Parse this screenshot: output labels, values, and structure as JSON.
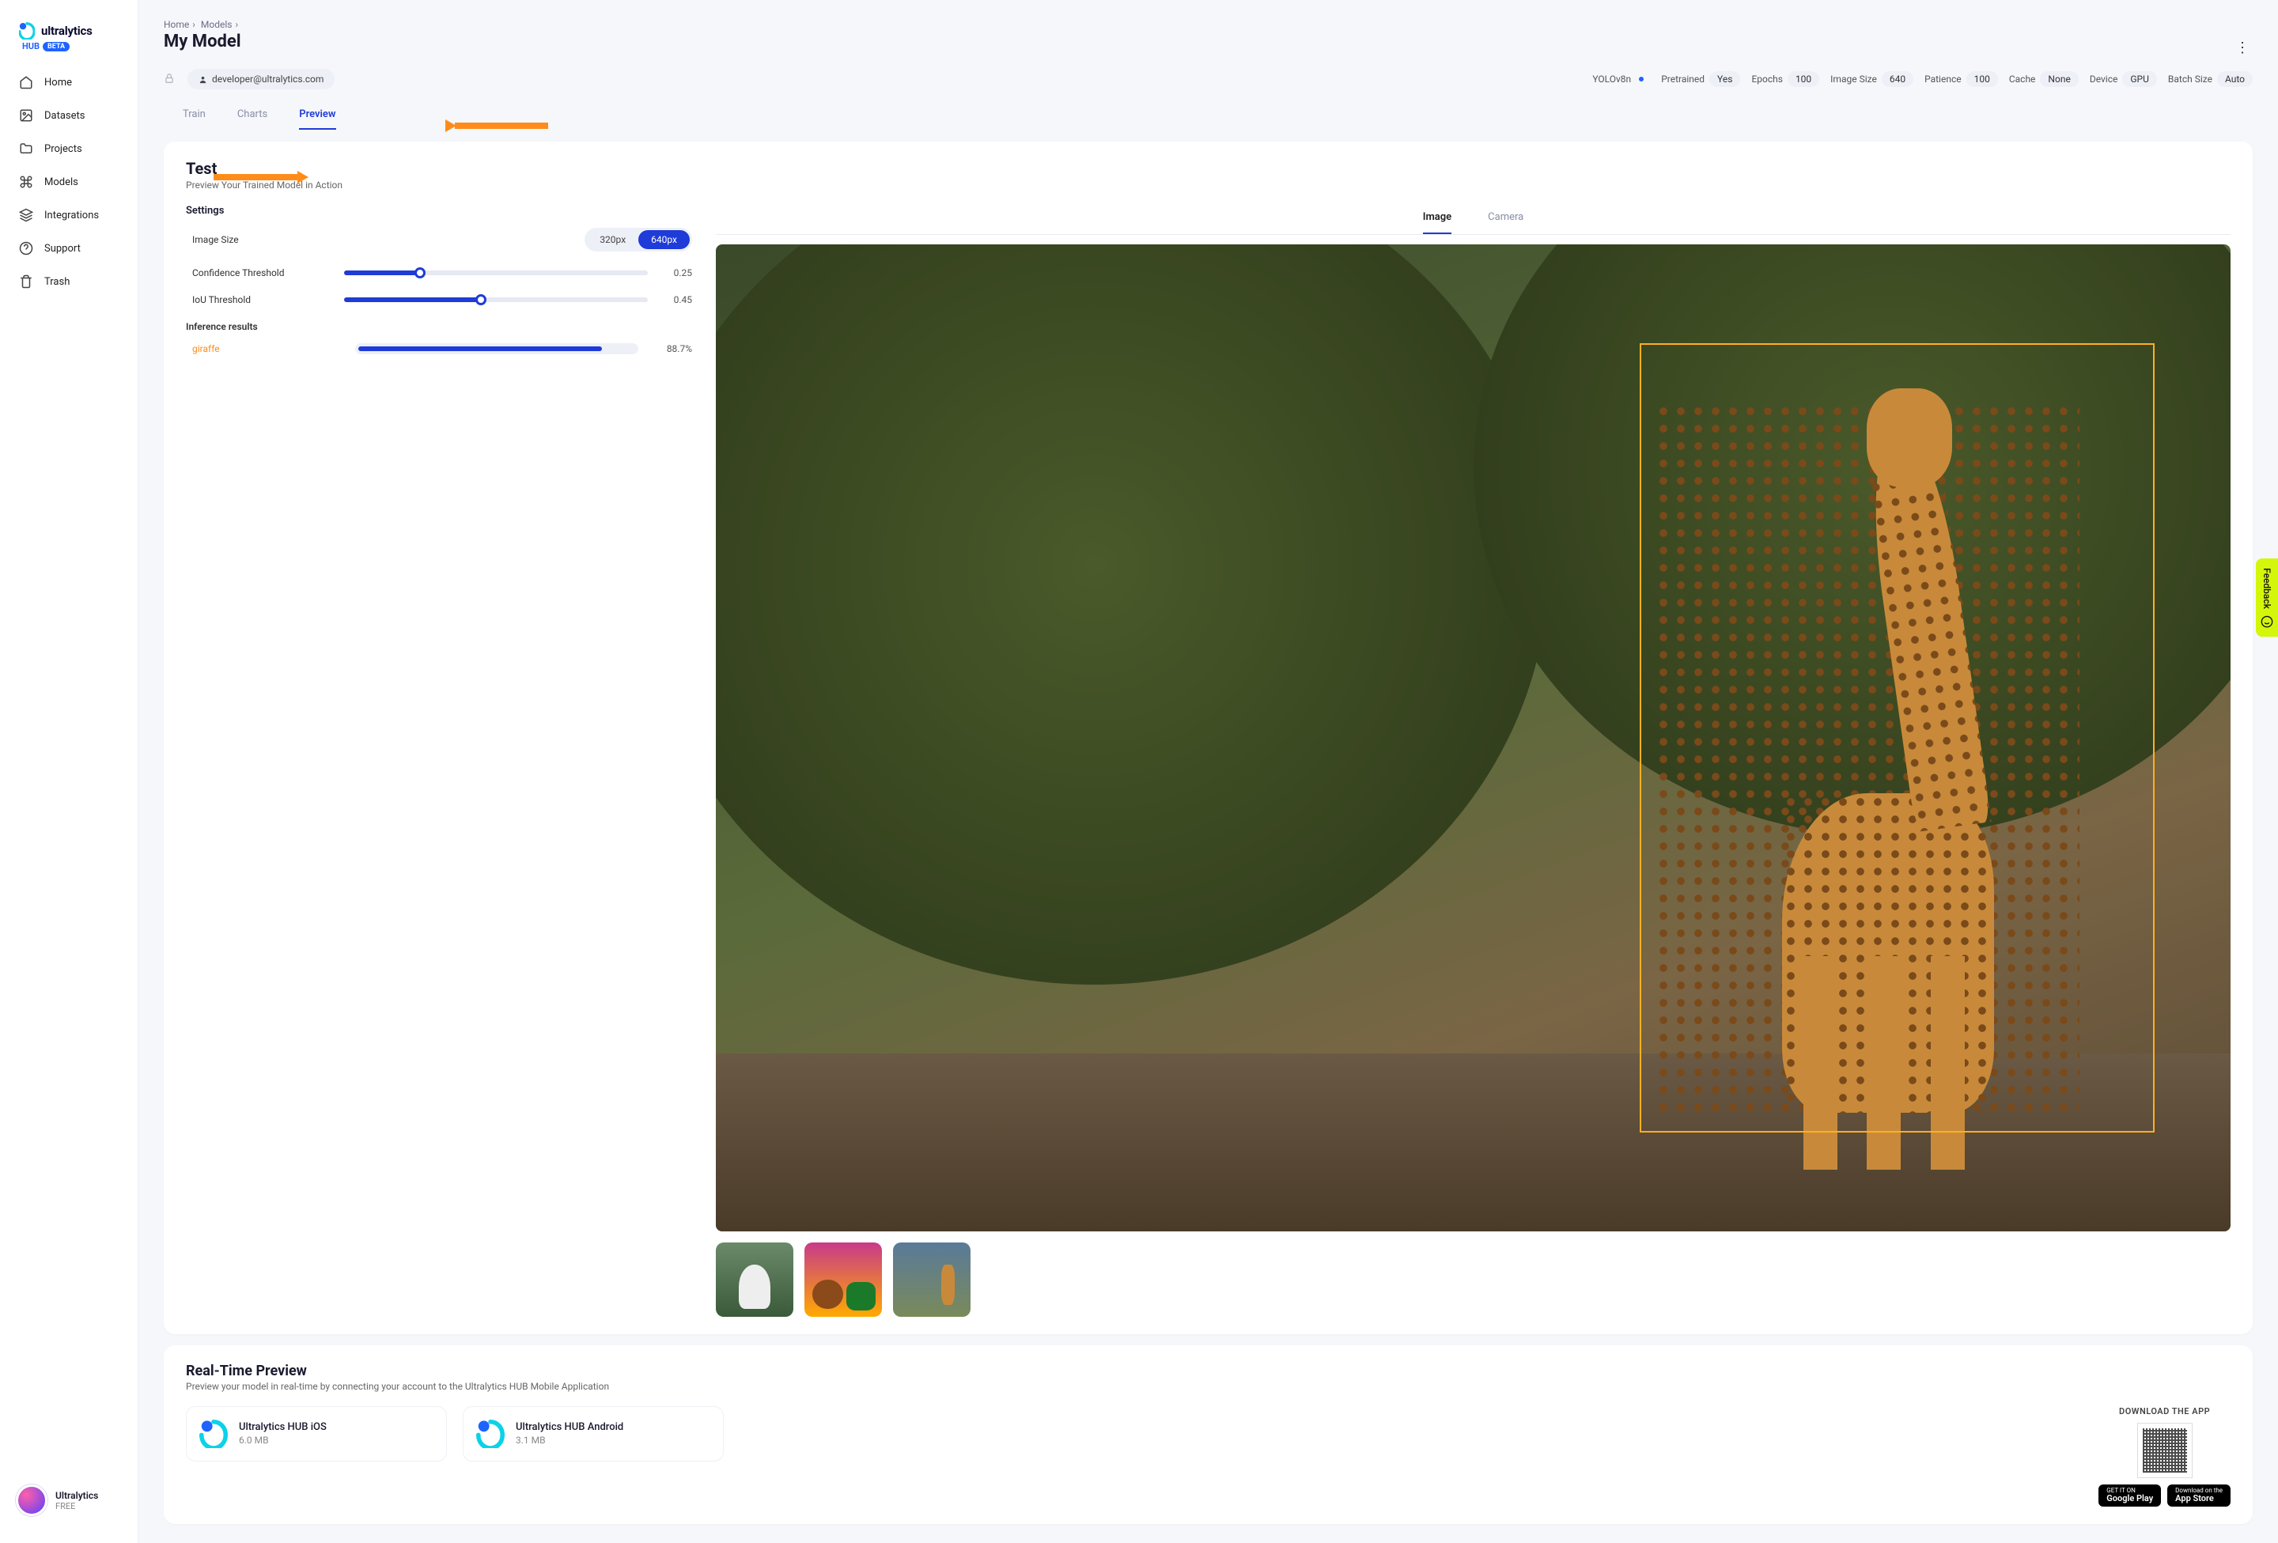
{
  "brand": {
    "name": "ultralytics",
    "sub": "HUB",
    "badge": "BETA"
  },
  "nav": {
    "home": "Home",
    "datasets": "Datasets",
    "projects": "Projects",
    "models": "Models",
    "integrations": "Integrations",
    "support": "Support",
    "trash": "Trash"
  },
  "account": {
    "name": "Ultralytics",
    "plan": "FREE"
  },
  "breadcrumb": {
    "home": "Home",
    "models": "Models"
  },
  "page": {
    "title": "My Model"
  },
  "meta": {
    "email": "developer@ultralytics.com",
    "model": "YOLOv8n",
    "pretrained_label": "Pretrained",
    "pretrained": "Yes",
    "epochs_label": "Epochs",
    "epochs": "100",
    "imgsize_label": "Image Size",
    "imgsize": "640",
    "patience_label": "Patience",
    "patience": "100",
    "cache_label": "Cache",
    "cache": "None",
    "device_label": "Device",
    "device": "GPU",
    "batch_label": "Batch Size",
    "batch": "Auto"
  },
  "tabs": {
    "train": "Train",
    "charts": "Charts",
    "preview": "Preview"
  },
  "test": {
    "title": "Test",
    "subtitle": "Preview Your Trained Model in Action",
    "settings_label": "Settings",
    "imgsize_label": "Image Size",
    "imgsize_options": {
      "a": "320px",
      "b": "640px"
    },
    "conf_label": "Confidence Threshold",
    "conf_value": "0.25",
    "iou_label": "IoU Threshold",
    "iou_value": "0.45",
    "inference_label": "Inference results",
    "result_name": "giraffe",
    "result_value": "88.7%"
  },
  "preview_tabs": {
    "image": "Image",
    "camera": "Camera"
  },
  "realtime": {
    "title": "Real-Time Preview",
    "subtitle": "Preview your model in real-time by connecting your account to the Ultralytics HUB Mobile Application",
    "ios_title": "Ultralytics HUB iOS",
    "ios_size": "6.0 MB",
    "android_title": "Ultralytics HUB Android",
    "android_size": "3.1 MB",
    "download_label": "DOWNLOAD THE APP",
    "gplay_small": "GET IT ON",
    "gplay_big": "Google Play",
    "astore_small": "Download on the",
    "astore_big": "App Store"
  },
  "feedback": "Feedback"
}
